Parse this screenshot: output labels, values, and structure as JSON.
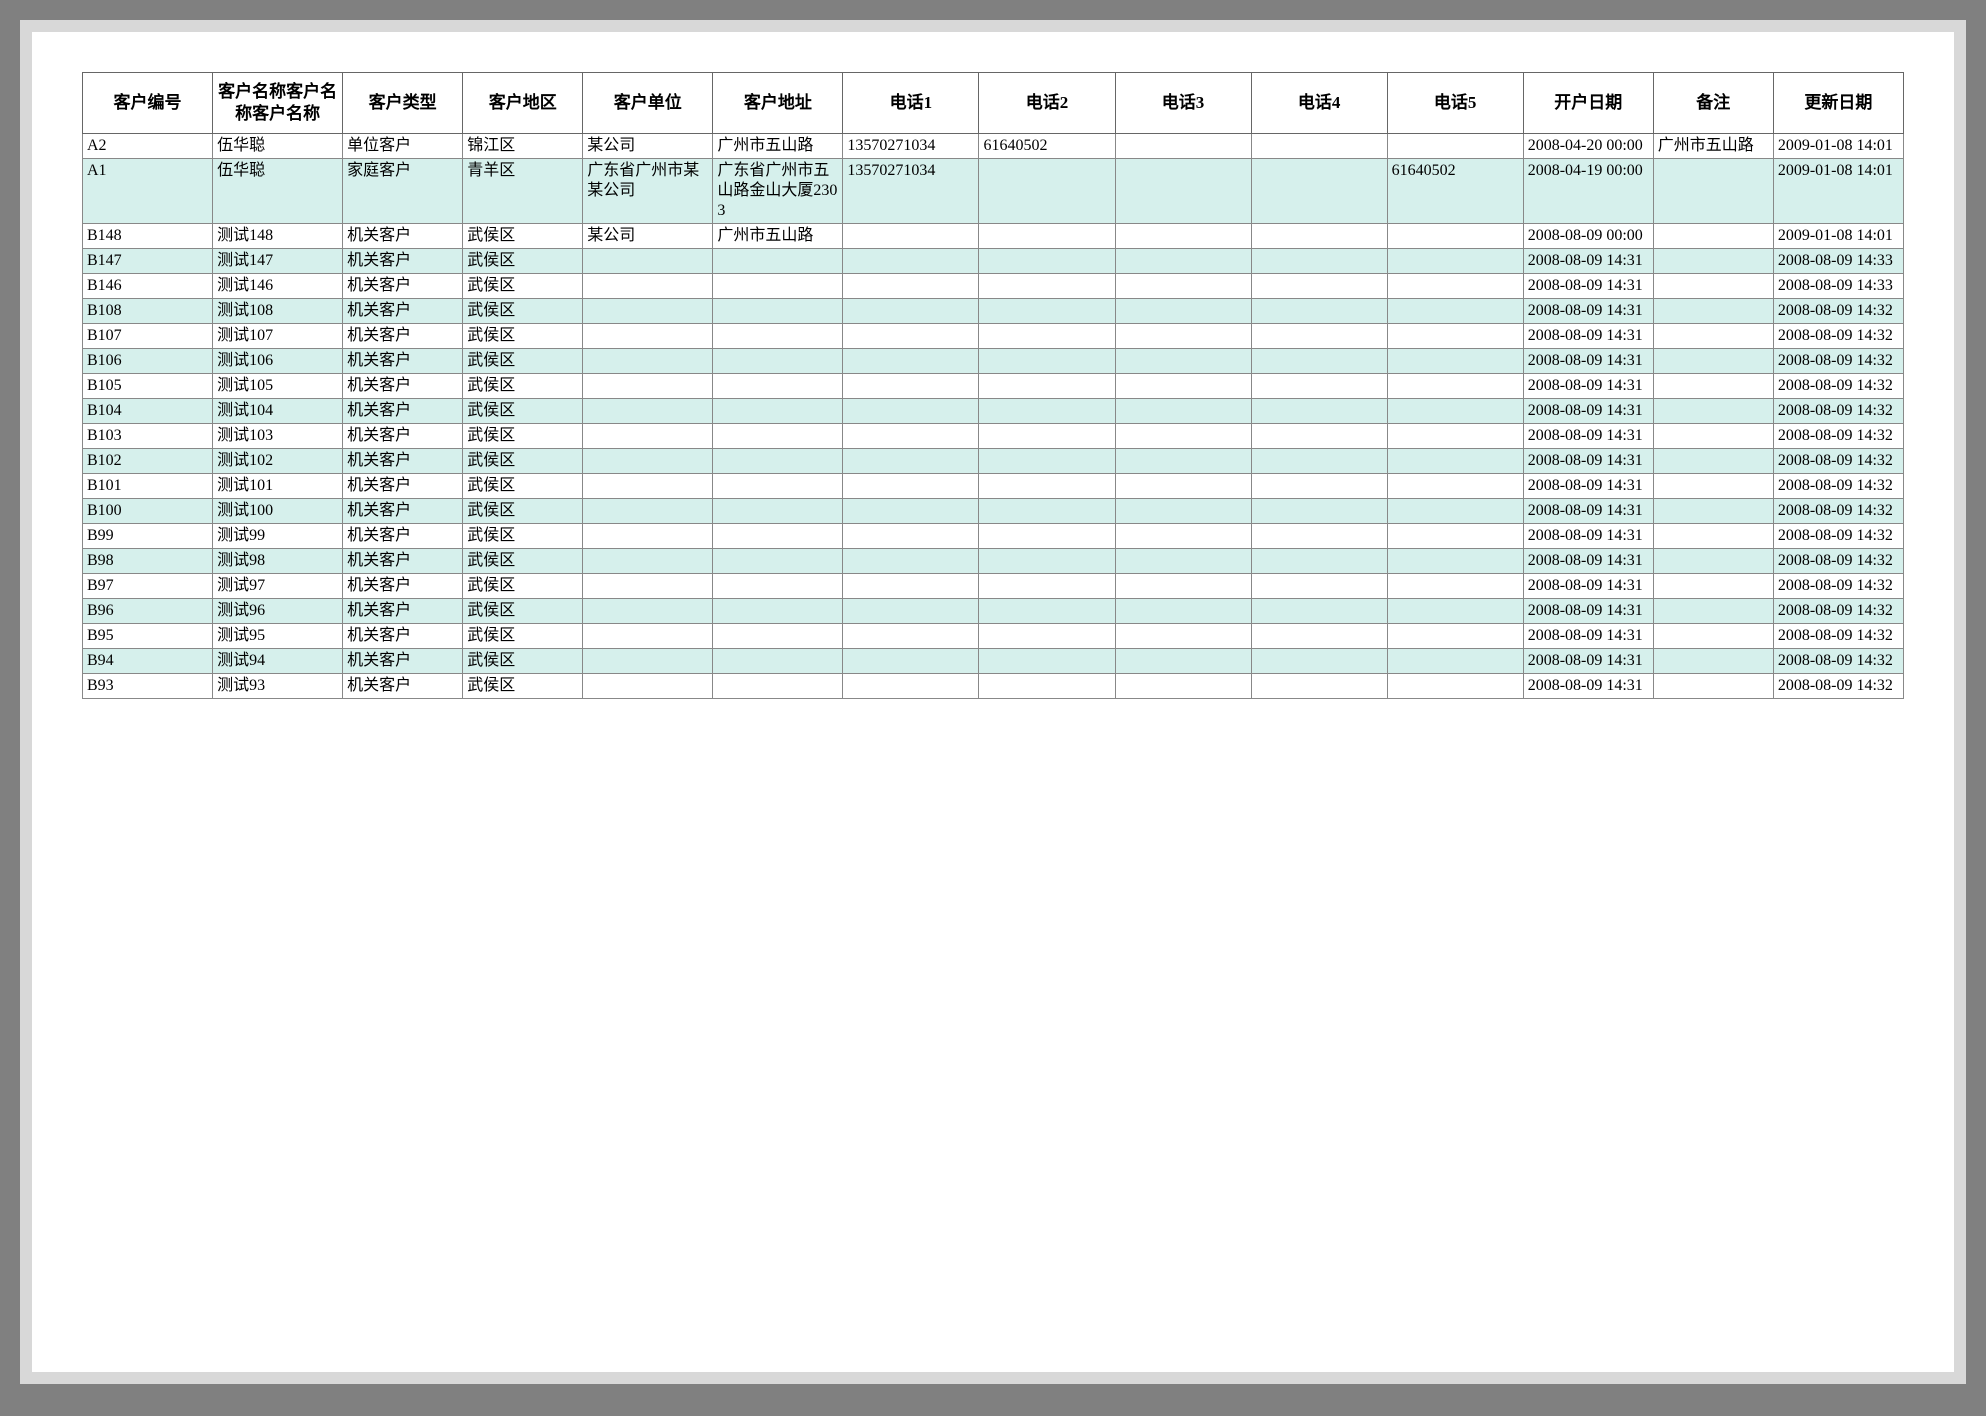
{
  "table": {
    "headers": {
      "id": "客户编号",
      "name": "客户名称客户名称客户名称",
      "type": "客户类型",
      "region": "客户地区",
      "unit": "客户单位",
      "addr": "客户地址",
      "tel1": "电话1",
      "tel2": "电话2",
      "tel3": "电话3",
      "tel4": "电话4",
      "tel5": "电话5",
      "open_date": "开户日期",
      "note": "备注",
      "update_date": "更新日期"
    },
    "rows": [
      {
        "id": "A2",
        "name": "伍华聪",
        "type": "单位客户",
        "region": "锦江区",
        "unit": "某公司",
        "addr": "广州市五山路",
        "tel1": "13570271034",
        "tel2": "61640502",
        "tel3": "",
        "tel4": "",
        "tel5": "",
        "open_date": "2008-04-20 00:00",
        "note": "广州市五山路",
        "update_date": "2009-01-08 14:01"
      },
      {
        "id": "A1",
        "name": "伍华聪",
        "type": "家庭客户",
        "region": "青羊区",
        "unit": "广东省广州市某某公司",
        "addr": "广东省广州市五山路金山大厦2303",
        "tel1": "13570271034",
        "tel2": "",
        "tel3": "",
        "tel4": "",
        "tel5": "61640502",
        "open_date": "2008-04-19 00:00",
        "note": "",
        "update_date": "2009-01-08 14:01"
      },
      {
        "id": "B148",
        "name": "测试148",
        "type": "机关客户",
        "region": "武侯区",
        "unit": "某公司",
        "addr": "广州市五山路",
        "tel1": "",
        "tel2": "",
        "tel3": "",
        "tel4": "",
        "tel5": "",
        "open_date": "2008-08-09 00:00",
        "note": "",
        "update_date": "2009-01-08 14:01"
      },
      {
        "id": "B147",
        "name": "测试147",
        "type": "机关客户",
        "region": "武侯区",
        "unit": "",
        "addr": "",
        "tel1": "",
        "tel2": "",
        "tel3": "",
        "tel4": "",
        "tel5": "",
        "open_date": "2008-08-09 14:31",
        "note": "",
        "update_date": "2008-08-09 14:33"
      },
      {
        "id": "B146",
        "name": "测试146",
        "type": "机关客户",
        "region": "武侯区",
        "unit": "",
        "addr": "",
        "tel1": "",
        "tel2": "",
        "tel3": "",
        "tel4": "",
        "tel5": "",
        "open_date": "2008-08-09 14:31",
        "note": "",
        "update_date": "2008-08-09 14:33"
      },
      {
        "id": "B108",
        "name": "测试108",
        "type": "机关客户",
        "region": "武侯区",
        "unit": "",
        "addr": "",
        "tel1": "",
        "tel2": "",
        "tel3": "",
        "tel4": "",
        "tel5": "",
        "open_date": "2008-08-09 14:31",
        "note": "",
        "update_date": "2008-08-09 14:32"
      },
      {
        "id": "B107",
        "name": "测试107",
        "type": "机关客户",
        "region": "武侯区",
        "unit": "",
        "addr": "",
        "tel1": "",
        "tel2": "",
        "tel3": "",
        "tel4": "",
        "tel5": "",
        "open_date": "2008-08-09 14:31",
        "note": "",
        "update_date": "2008-08-09 14:32"
      },
      {
        "id": "B106",
        "name": "测试106",
        "type": "机关客户",
        "region": "武侯区",
        "unit": "",
        "addr": "",
        "tel1": "",
        "tel2": "",
        "tel3": "",
        "tel4": "",
        "tel5": "",
        "open_date": "2008-08-09 14:31",
        "note": "",
        "update_date": "2008-08-09 14:32"
      },
      {
        "id": "B105",
        "name": "测试105",
        "type": "机关客户",
        "region": "武侯区",
        "unit": "",
        "addr": "",
        "tel1": "",
        "tel2": "",
        "tel3": "",
        "tel4": "",
        "tel5": "",
        "open_date": "2008-08-09 14:31",
        "note": "",
        "update_date": "2008-08-09 14:32"
      },
      {
        "id": "B104",
        "name": "测试104",
        "type": "机关客户",
        "region": "武侯区",
        "unit": "",
        "addr": "",
        "tel1": "",
        "tel2": "",
        "tel3": "",
        "tel4": "",
        "tel5": "",
        "open_date": "2008-08-09 14:31",
        "note": "",
        "update_date": "2008-08-09 14:32"
      },
      {
        "id": "B103",
        "name": "测试103",
        "type": "机关客户",
        "region": "武侯区",
        "unit": "",
        "addr": "",
        "tel1": "",
        "tel2": "",
        "tel3": "",
        "tel4": "",
        "tel5": "",
        "open_date": "2008-08-09 14:31",
        "note": "",
        "update_date": "2008-08-09 14:32"
      },
      {
        "id": "B102",
        "name": "测试102",
        "type": "机关客户",
        "region": "武侯区",
        "unit": "",
        "addr": "",
        "tel1": "",
        "tel2": "",
        "tel3": "",
        "tel4": "",
        "tel5": "",
        "open_date": "2008-08-09 14:31",
        "note": "",
        "update_date": "2008-08-09 14:32"
      },
      {
        "id": "B101",
        "name": "测试101",
        "type": "机关客户",
        "region": "武侯区",
        "unit": "",
        "addr": "",
        "tel1": "",
        "tel2": "",
        "tel3": "",
        "tel4": "",
        "tel5": "",
        "open_date": "2008-08-09 14:31",
        "note": "",
        "update_date": "2008-08-09 14:32"
      },
      {
        "id": "B100",
        "name": "测试100",
        "type": "机关客户",
        "region": "武侯区",
        "unit": "",
        "addr": "",
        "tel1": "",
        "tel2": "",
        "tel3": "",
        "tel4": "",
        "tel5": "",
        "open_date": "2008-08-09 14:31",
        "note": "",
        "update_date": "2008-08-09 14:32"
      },
      {
        "id": "B99",
        "name": "测试99",
        "type": "机关客户",
        "region": "武侯区",
        "unit": "",
        "addr": "",
        "tel1": "",
        "tel2": "",
        "tel3": "",
        "tel4": "",
        "tel5": "",
        "open_date": "2008-08-09 14:31",
        "note": "",
        "update_date": "2008-08-09 14:32"
      },
      {
        "id": "B98",
        "name": "测试98",
        "type": "机关客户",
        "region": "武侯区",
        "unit": "",
        "addr": "",
        "tel1": "",
        "tel2": "",
        "tel3": "",
        "tel4": "",
        "tel5": "",
        "open_date": "2008-08-09 14:31",
        "note": "",
        "update_date": "2008-08-09 14:32"
      },
      {
        "id": "B97",
        "name": "测试97",
        "type": "机关客户",
        "region": "武侯区",
        "unit": "",
        "addr": "",
        "tel1": "",
        "tel2": "",
        "tel3": "",
        "tel4": "",
        "tel5": "",
        "open_date": "2008-08-09 14:31",
        "note": "",
        "update_date": "2008-08-09 14:32"
      },
      {
        "id": "B96",
        "name": "测试96",
        "type": "机关客户",
        "region": "武侯区",
        "unit": "",
        "addr": "",
        "tel1": "",
        "tel2": "",
        "tel3": "",
        "tel4": "",
        "tel5": "",
        "open_date": "2008-08-09 14:31",
        "note": "",
        "update_date": "2008-08-09 14:32"
      },
      {
        "id": "B95",
        "name": "测试95",
        "type": "机关客户",
        "region": "武侯区",
        "unit": "",
        "addr": "",
        "tel1": "",
        "tel2": "",
        "tel3": "",
        "tel4": "",
        "tel5": "",
        "open_date": "2008-08-09 14:31",
        "note": "",
        "update_date": "2008-08-09 14:32"
      },
      {
        "id": "B94",
        "name": "测试94",
        "type": "机关客户",
        "region": "武侯区",
        "unit": "",
        "addr": "",
        "tel1": "",
        "tel2": "",
        "tel3": "",
        "tel4": "",
        "tel5": "",
        "open_date": "2008-08-09 14:31",
        "note": "",
        "update_date": "2008-08-09 14:32"
      },
      {
        "id": "B93",
        "name": "测试93",
        "type": "机关客户",
        "region": "武侯区",
        "unit": "",
        "addr": "",
        "tel1": "",
        "tel2": "",
        "tel3": "",
        "tel4": "",
        "tel5": "",
        "open_date": "2008-08-09 14:31",
        "note": "",
        "update_date": "2008-08-09 14:32"
      }
    ]
  }
}
